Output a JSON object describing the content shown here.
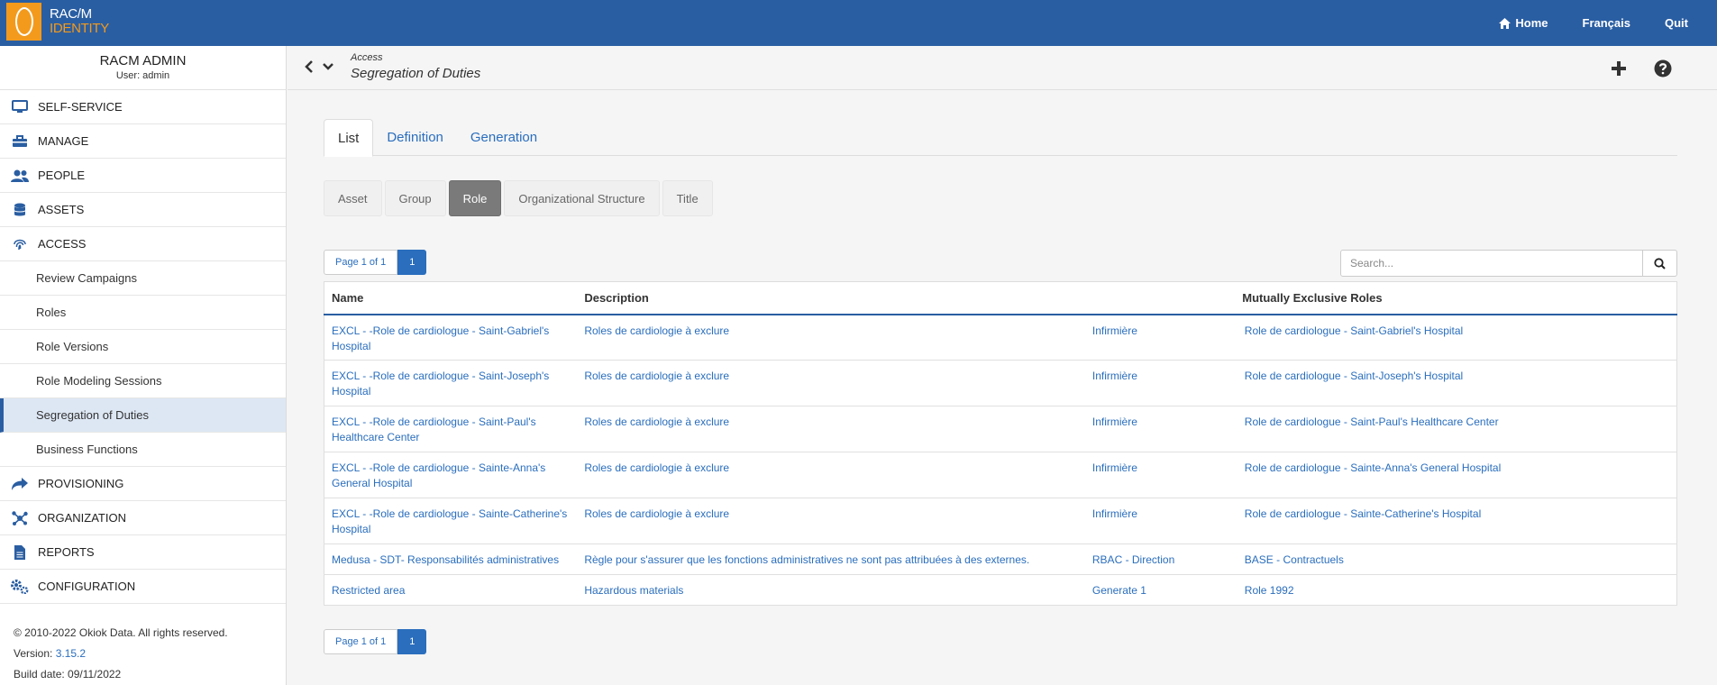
{
  "app": {
    "logo_line1": "RAC/M",
    "logo_line2": "IDENTITY"
  },
  "topnav": {
    "home": "Home",
    "language": "Français",
    "quit": "Quit"
  },
  "sidebar": {
    "title": "RACM ADMIN",
    "user": "User: admin",
    "items": [
      {
        "label": "SELF-SERVICE",
        "icon": "monitor-icon"
      },
      {
        "label": "MANAGE",
        "icon": "toolbox-icon"
      },
      {
        "label": "PEOPLE",
        "icon": "users-icon"
      },
      {
        "label": "ASSETS",
        "icon": "database-icon"
      },
      {
        "label": "ACCESS",
        "icon": "fingerprint-icon"
      }
    ],
    "access_sub": [
      "Review Campaigns",
      "Roles",
      "Role Versions",
      "Role Modeling Sessions",
      "Segregation of Duties",
      "Business Functions"
    ],
    "items_after": [
      {
        "label": "PROVISIONING",
        "icon": "share-icon"
      },
      {
        "label": "ORGANIZATION",
        "icon": "network-icon"
      },
      {
        "label": "REPORTS",
        "icon": "file-icon"
      },
      {
        "label": "CONFIGURATION",
        "icon": "gears-icon"
      }
    ],
    "footer": {
      "copyright": "© 2010-2022 Okiok Data. All rights reserved.",
      "version_label": "Version:",
      "version": "3.15.2",
      "build": "Build date: 09/11/2022"
    }
  },
  "breadcrumb": {
    "section": "Access",
    "title": "Segregation of Duties"
  },
  "tabs": [
    "List",
    "Definition",
    "Generation"
  ],
  "filters": [
    "Asset",
    "Group",
    "Role",
    "Organizational Structure",
    "Title"
  ],
  "pager": {
    "label": "Page 1 of 1",
    "page": "1"
  },
  "search": {
    "placeholder": "Search..."
  },
  "table": {
    "headers": [
      "Name",
      "Description",
      "",
      "Mutually Exclusive Roles"
    ],
    "rows": [
      {
        "name": "EXCL - -Role de cardiologue - Saint-Gabriel's Hospital",
        "description": "Roles de cardiologie à exclure",
        "role_a": "Infirmière",
        "role_b": "Role de cardiologue - Saint-Gabriel's Hospital"
      },
      {
        "name": "EXCL - -Role de cardiologue - Saint-Joseph's Hospital",
        "description": "Roles de cardiologie à exclure",
        "role_a": "Infirmière",
        "role_b": "Role de cardiologue - Saint-Joseph's Hospital"
      },
      {
        "name": "EXCL - -Role de cardiologue - Saint-Paul's Healthcare Center",
        "description": "Roles de cardiologie à exclure",
        "role_a": "Infirmière",
        "role_b": "Role de cardiologue - Saint-Paul's Healthcare Center"
      },
      {
        "name": "EXCL - -Role de cardiologue - Sainte-Anna's General Hospital",
        "description": "Roles de cardiologie à exclure",
        "role_a": "Infirmière",
        "role_b": "Role de cardiologue - Sainte-Anna's General Hospital"
      },
      {
        "name": "EXCL - -Role de cardiologue - Sainte-Catherine's Hospital",
        "description": "Roles de cardiologie à exclure",
        "role_a": "Infirmière",
        "role_b": "Role de cardiologue - Sainte-Catherine's Hospital"
      },
      {
        "name": "Medusa - SDT- Responsabilités administratives",
        "description": "Règle pour s'assurer que les fonctions administratives ne sont pas attribuées à des externes.",
        "role_a": "RBAC - Direction",
        "role_b": "BASE - Contractuels"
      },
      {
        "name": "Restricted area",
        "description": "Hazardous materials",
        "role_a": "Generate 1",
        "role_b": "Role 1992"
      }
    ]
  }
}
